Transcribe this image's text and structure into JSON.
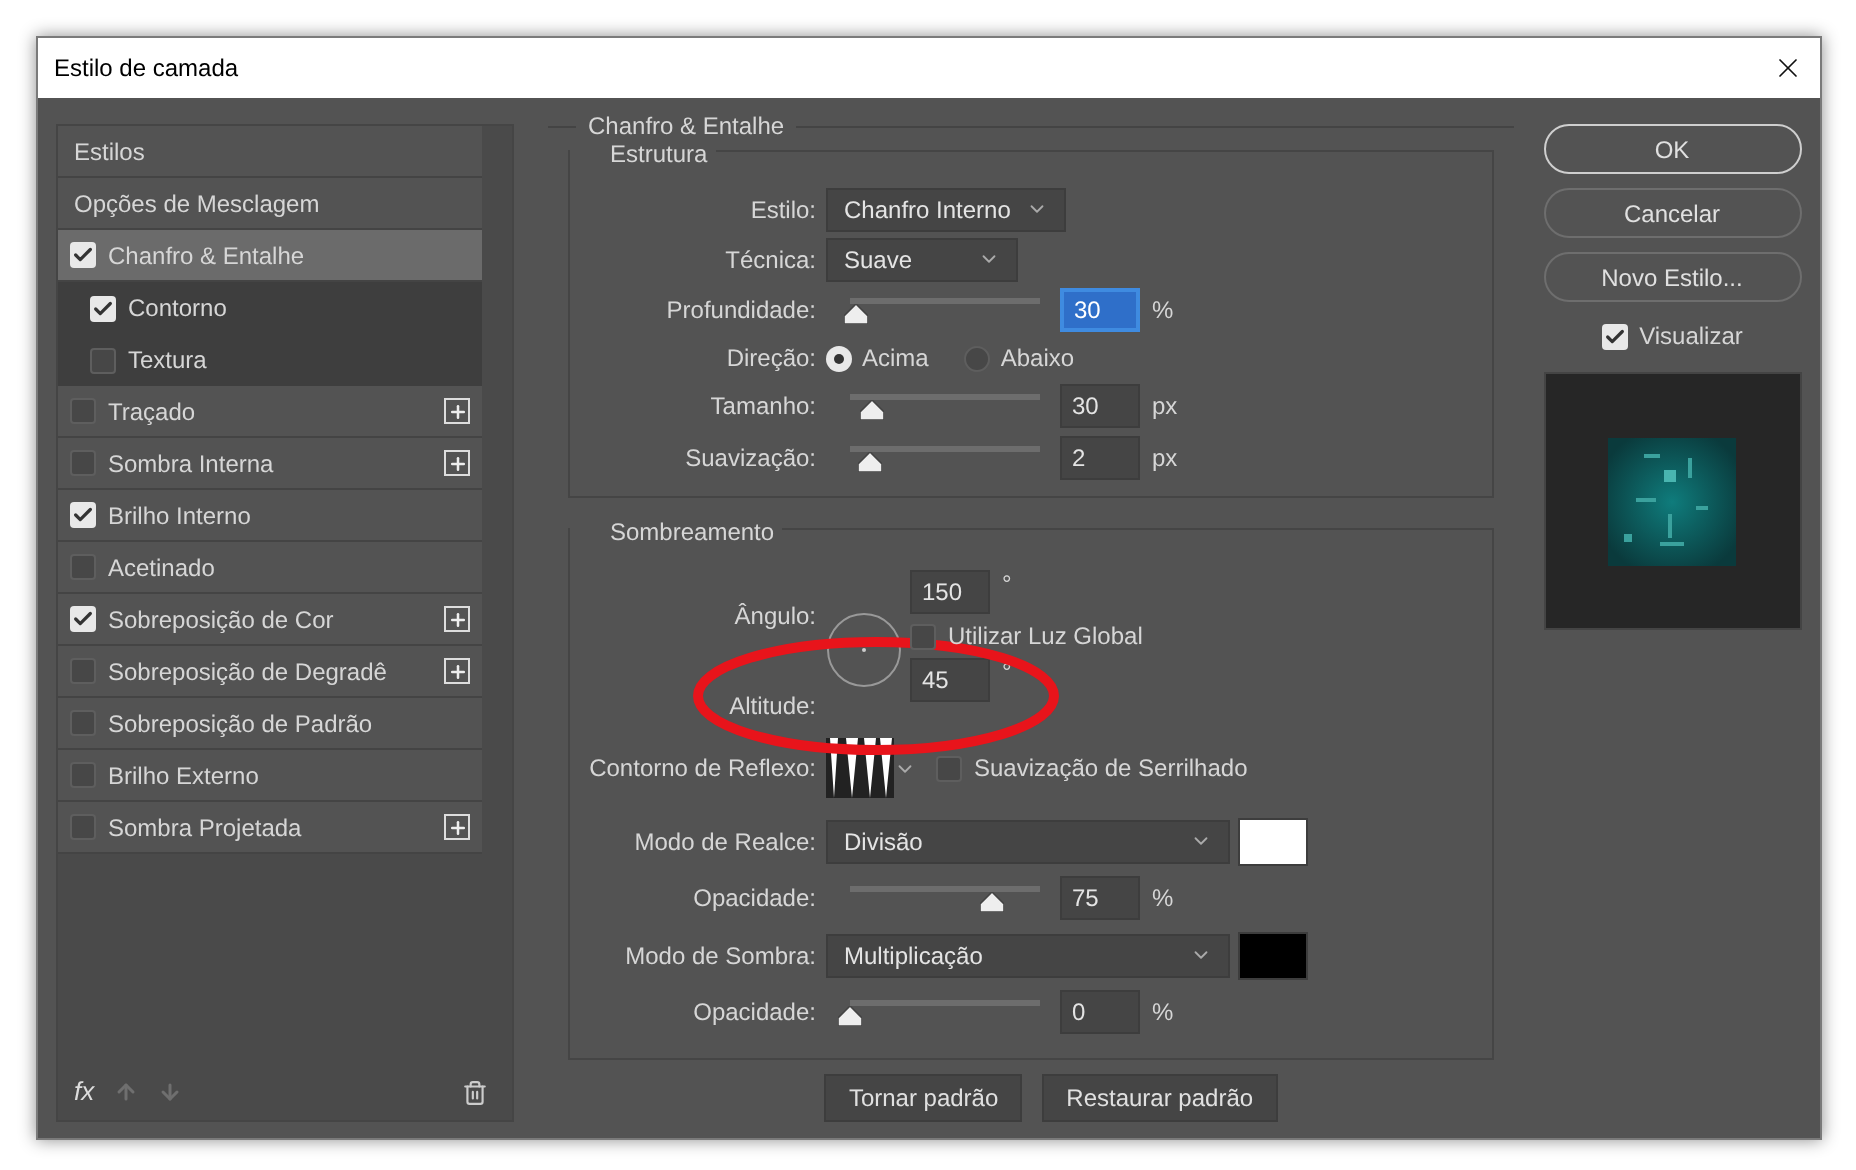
{
  "window": {
    "title": "Estilo de camada"
  },
  "styles_panel": {
    "items": [
      {
        "kind": "header",
        "label": "Estilos",
        "selected": false
      },
      {
        "kind": "header",
        "label": "Opções de Mesclagem",
        "selected": false
      },
      {
        "kind": "effect",
        "label": "Chanfro & Entalhe",
        "checked": true,
        "selected": true,
        "addable": false,
        "children": [
          {
            "label": "Contorno",
            "checked": true
          },
          {
            "label": "Textura",
            "checked": false
          }
        ]
      },
      {
        "kind": "effect",
        "label": "Traçado",
        "checked": false,
        "selected": false,
        "addable": true
      },
      {
        "kind": "effect",
        "label": "Sombra Interna",
        "checked": false,
        "selected": false,
        "addable": true
      },
      {
        "kind": "effect",
        "label": "Brilho Interno",
        "checked": true,
        "selected": false,
        "addable": false
      },
      {
        "kind": "effect",
        "label": "Acetinado",
        "checked": false,
        "selected": false,
        "addable": false
      },
      {
        "kind": "effect",
        "label": "Sobreposição de Cor",
        "checked": true,
        "selected": false,
        "addable": true
      },
      {
        "kind": "effect",
        "label": "Sobreposição de Degradê",
        "checked": false,
        "selected": false,
        "addable": true
      },
      {
        "kind": "effect",
        "label": "Sobreposição de Padrão",
        "checked": false,
        "selected": false,
        "addable": false
      },
      {
        "kind": "effect",
        "label": "Brilho Externo",
        "checked": false,
        "selected": false,
        "addable": false
      },
      {
        "kind": "effect",
        "label": "Sombra Projetada",
        "checked": false,
        "selected": false,
        "addable": true
      }
    ],
    "fx": "fx"
  },
  "section_title": "Chanfro & Entalhe",
  "structure": {
    "title": "Estrutura",
    "rows": [
      {
        "kind": "select",
        "label": "Estilo:",
        "value": "Chanfro Interno"
      },
      {
        "kind": "select",
        "label": "Técnica:",
        "value": "Suave"
      },
      {
        "kind": "slider",
        "label": "Profundidade:",
        "level": 0.03,
        "value": "30",
        "unit": "%",
        "focused": true
      },
      {
        "kind": "radio",
        "label": "Direção:",
        "options": [
          {
            "label": "Acima",
            "selected": true
          },
          {
            "label": "Abaixo",
            "selected": false
          }
        ]
      },
      {
        "kind": "slider",
        "label": "Tamanho:",
        "level": 0.12,
        "value": "30",
        "unit": "px",
        "focused": false
      },
      {
        "kind": "slider",
        "label": "Suavização:",
        "level": 0.1,
        "value": "2",
        "unit": "px",
        "focused": false
      }
    ]
  },
  "shading": {
    "title": "Sombreamento",
    "angle": {
      "label": "Ângulo:",
      "value": "150",
      "unit": "°"
    },
    "global_light": {
      "label": "Utilizar Luz Global",
      "checked": false
    },
    "altitude": {
      "label": "Altitude:",
      "value": "45",
      "unit": "°"
    },
    "gloss_contour": {
      "label": "Contorno de Reflexo:"
    },
    "anti_aliased": {
      "label": "Suavização de Serrilhado",
      "checked": false
    },
    "rows": [
      {
        "kind": "select",
        "label": "Modo de Realce:",
        "value": "Divisão",
        "color": "#ffffff"
      },
      {
        "kind": "slider",
        "label": "Opacidade:",
        "level": 0.75,
        "value": "75",
        "unit": "%",
        "focused": false
      },
      {
        "kind": "select",
        "label": "Modo de Sombra:",
        "value": "Multiplicação",
        "color": "#000000"
      },
      {
        "kind": "slider",
        "label": "Opacidade:",
        "level": 0,
        "value": "0",
        "unit": "%",
        "focused": false
      }
    ]
  },
  "bottom_buttons": [
    "Tornar padrão",
    "Restaurar padrão"
  ],
  "side_buttons": [
    {
      "label": "OK",
      "default": true
    },
    {
      "label": "Cancelar",
      "default": false
    },
    {
      "label": "Novo Estilo...",
      "default": false
    }
  ],
  "preview": {
    "label": "Visualizar",
    "checked": true
  }
}
